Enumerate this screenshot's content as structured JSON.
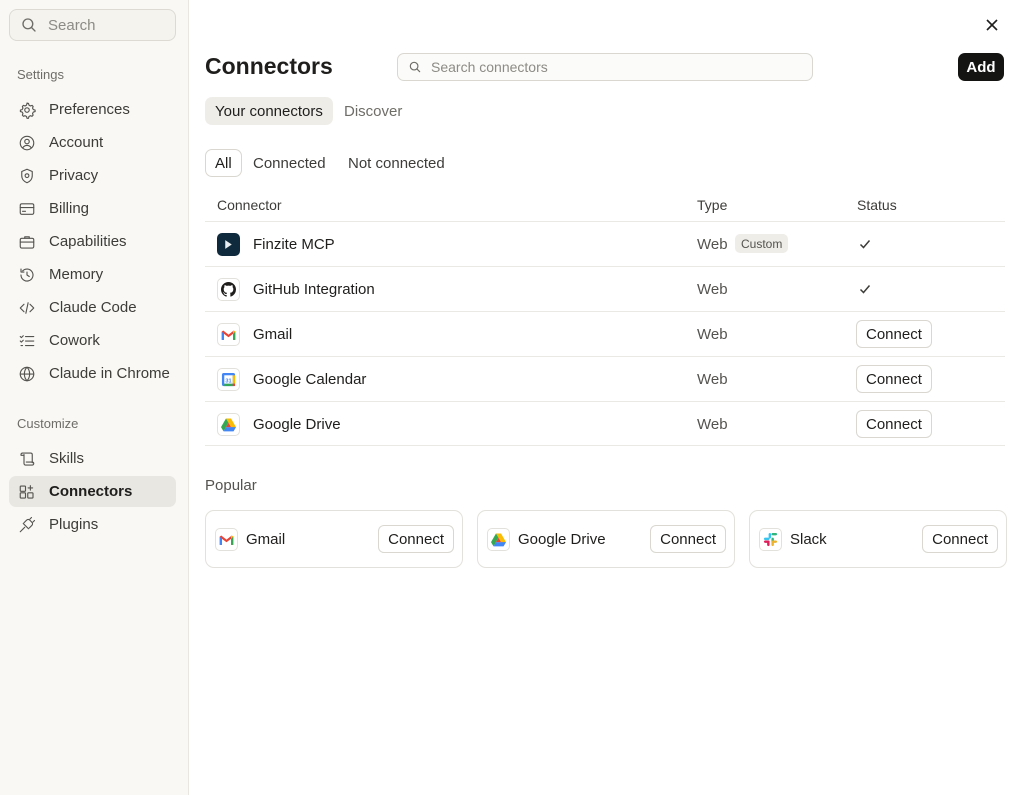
{
  "sidebar": {
    "search_placeholder": "Search",
    "section_settings": "Settings",
    "section_customize": "Customize",
    "settings_items": [
      {
        "label": "Preferences",
        "icon": "gear-icon"
      },
      {
        "label": "Account",
        "icon": "user-circle-icon"
      },
      {
        "label": "Privacy",
        "icon": "shield-icon"
      },
      {
        "label": "Billing",
        "icon": "credit-card-icon"
      },
      {
        "label": "Capabilities",
        "icon": "briefcase-icon"
      },
      {
        "label": "Memory",
        "icon": "history-icon"
      },
      {
        "label": "Claude Code",
        "icon": "code-icon"
      },
      {
        "label": "Cowork",
        "icon": "checklist-icon"
      },
      {
        "label": "Claude in Chrome",
        "icon": "globe-icon"
      }
    ],
    "customize_items": [
      {
        "label": "Skills",
        "icon": "scroll-icon"
      },
      {
        "label": "Connectors",
        "icon": "connectors-icon",
        "active": true
      },
      {
        "label": "Plugins",
        "icon": "plug-icon"
      }
    ]
  },
  "header": {
    "title": "Connectors",
    "search_placeholder": "Search connectors",
    "add_label": "Add"
  },
  "tabs": [
    "Your connectors",
    "Discover"
  ],
  "filters": [
    "All",
    "Connected",
    "Not connected"
  ],
  "table": {
    "columns": [
      "Connector",
      "Type",
      "Status"
    ],
    "rows": [
      {
        "name": "Finzite MCP",
        "type": "Web",
        "badge": "Custom",
        "status": "connected",
        "logo": "finzite-logo-icon"
      },
      {
        "name": "GitHub Integration",
        "type": "Web",
        "badge": "",
        "status": "connected",
        "logo": "github-icon"
      },
      {
        "name": "Gmail",
        "type": "Web",
        "badge": "",
        "status": "Connect",
        "logo": "gmail-icon"
      },
      {
        "name": "Google Calendar",
        "type": "Web",
        "badge": "",
        "status": "Connect",
        "logo": "google-calendar-icon"
      },
      {
        "name": "Google Drive",
        "type": "Web",
        "badge": "",
        "status": "Connect",
        "logo": "google-drive-icon"
      }
    ]
  },
  "popular": {
    "title": "Popular",
    "cards": [
      {
        "name": "Gmail",
        "button": "Connect",
        "logo": "gmail-icon"
      },
      {
        "name": "Google Drive",
        "button": "Connect",
        "logo": "google-drive-icon"
      },
      {
        "name": "Slack",
        "button": "Connect",
        "logo": "slack-icon"
      }
    ]
  },
  "colors": {
    "sidebar_bg": "#f9f8f5",
    "active_item_bg": "#e9e7e1",
    "add_button_bg": "#141413"
  }
}
